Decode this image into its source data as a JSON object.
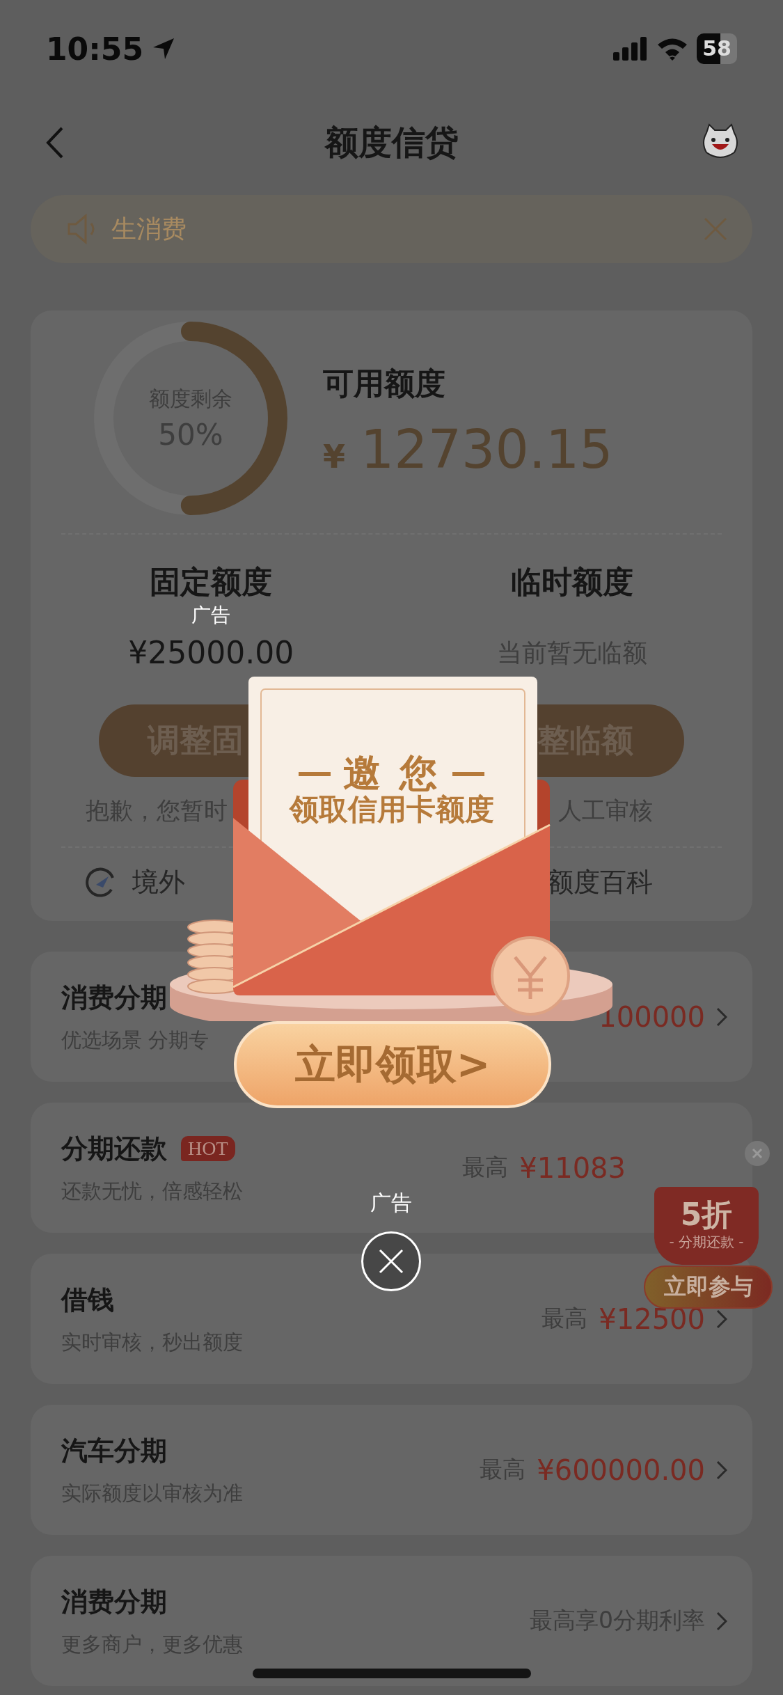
{
  "status_bar": {
    "time": "10:55",
    "battery": "58"
  },
  "nav": {
    "title": "额度信贷"
  },
  "notice": {
    "text": "生消费"
  },
  "credit": {
    "ring": {
      "label": "额度剩余",
      "percent": "50%",
      "level": 0.5
    },
    "available": {
      "label": "可用额度",
      "currency": "¥",
      "amount": "12730.15"
    },
    "fixed": {
      "title": "固定额度",
      "ad_label": "广告",
      "amount": "¥25000.00",
      "button": "调整固"
    },
    "temporary": {
      "title": "临时额度",
      "status": "当前暂无临额",
      "button": "整临额"
    },
    "notes": [
      "抱歉，您暂时",
      "人工审核"
    ],
    "links": [
      "境外",
      "额度百科"
    ]
  },
  "products": [
    {
      "title": "消费分期",
      "subtitle": "优选场景 分期专",
      "amount": "100000",
      "chevron": true
    },
    {
      "title": "分期还款",
      "badge": "HOT",
      "subtitle": "还款无忧，倍感轻松",
      "label": "最高",
      "amount": "¥11083",
      "chevron": false
    },
    {
      "title": "借钱",
      "subtitle": "实时审核，秒出额度",
      "label": "最高",
      "amount": "¥12500",
      "chevron": true
    },
    {
      "title": "汽车分期",
      "subtitle": "实际额度以审核为准",
      "label": "最高",
      "amount": "¥600000.00",
      "chevron": true
    },
    {
      "title": "消费分期",
      "subtitle": "更多商户，更多优惠",
      "label": "最高享0分期利率",
      "chevron": true
    }
  ],
  "popup": {
    "headline": "邀 您",
    "subline": "领取信用卡额度",
    "button": "立即领取>",
    "ad_label": "广告"
  },
  "float_ad": {
    "discount": "5折",
    "caption": "- 分期还款 -",
    "button": "立即参与"
  }
}
